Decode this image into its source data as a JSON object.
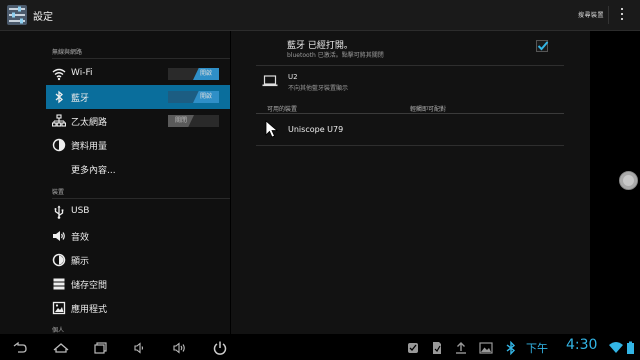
{
  "app": {
    "title": "設定",
    "search_label": "搜尋裝置"
  },
  "sections": {
    "wireless": "無線與網路",
    "device": "裝置",
    "personal": "個人"
  },
  "items": {
    "wifi": {
      "label": "Wi-Fi",
      "toggle": "開啟"
    },
    "bluetooth": {
      "label": "藍牙",
      "toggle": "開啟"
    },
    "ethernet": {
      "label": "乙太網路",
      "toggle": "關閉"
    },
    "data_usage": {
      "label": "資料用量"
    },
    "more": {
      "label": "更多內容..."
    },
    "usb": {
      "label": "USB"
    },
    "sound": {
      "label": "音效"
    },
    "display": {
      "label": "顯示"
    },
    "storage": {
      "label": "儲存空間"
    },
    "apps": {
      "label": "應用程式"
    }
  },
  "bluetooth_panel": {
    "title": "藍牙 已經打開。",
    "subtitle": "bluetooth 已激活。點擊可將其關閉",
    "checked": true,
    "this_device": {
      "name": "U2",
      "status": "不向其他藍牙裝置顯示"
    },
    "available_header": "可用的裝置",
    "pair_hint": "輕觸即可配對",
    "devices": [
      {
        "name": "Uniscope U79"
      }
    ]
  },
  "status": {
    "ampm": "下午",
    "time": "4:30"
  },
  "colors": {
    "accent": "#33b5e5",
    "selected": "#0a6e9c"
  }
}
